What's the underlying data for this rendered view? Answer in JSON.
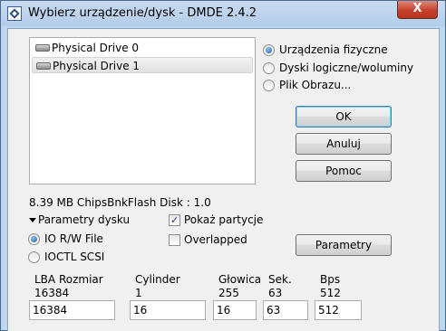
{
  "window": {
    "title": "Wybierz urządzenie/dysk - DMDE 2.4.2",
    "close_label": "X"
  },
  "drives": [
    {
      "label": "Physical Drive 0",
      "selected": false
    },
    {
      "label": "Physical Drive 1",
      "selected": true
    }
  ],
  "source_options": [
    {
      "label": "Urządzenia fizyczne",
      "checked": true
    },
    {
      "label": "Dyski logiczne/woluminy",
      "checked": false
    },
    {
      "label": "Plik Obrazu...",
      "checked": false
    }
  ],
  "buttons": {
    "ok": "OK",
    "cancel": "Anuluj",
    "help": "Pomoc",
    "params": "Parametry"
  },
  "disk_info": "8.39 MB ChipsBnkFlash Disk : 1.0",
  "disk_params": {
    "toggle_label": "Parametry dysku",
    "io_rw_file": {
      "label": "IO R/W File",
      "checked": true
    },
    "ioctl_scsi": {
      "label": "IOCTL SCSI",
      "checked": false
    },
    "show_partitions": {
      "label": "Pokaż partycje",
      "checked": true
    },
    "overlapped": {
      "label": "Overlapped",
      "checked": false
    }
  },
  "geometry": [
    {
      "header": "LBA Rozmiar",
      "current": "16384",
      "value": "16384"
    },
    {
      "header": "Cylinder",
      "current": "1",
      "value": "16"
    },
    {
      "header": "Głowica",
      "current": "255",
      "value": "16"
    },
    {
      "header": "Sek.",
      "current": "63",
      "value": "63"
    },
    {
      "header": "Bps",
      "current": "512",
      "value": "512"
    }
  ],
  "colors": {
    "title_bar": "#bfd6ee",
    "close_button": "#c4402c",
    "dialog_background": "#f0f0f0"
  }
}
